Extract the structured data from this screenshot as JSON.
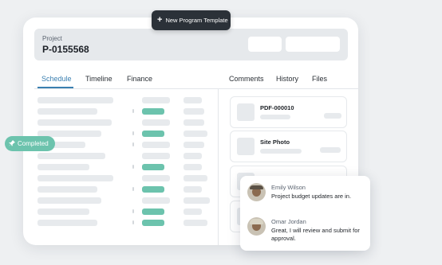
{
  "toolbar": {
    "new_template_label": "New Program Template",
    "plus_icon": "+"
  },
  "project": {
    "label": "Project",
    "id": "P-0155568"
  },
  "tabs_left": [
    "Schedule",
    "Timeline",
    "Finance"
  ],
  "tabs_right": [
    "Comments",
    "History",
    "Files"
  ],
  "status_badge": {
    "label": "Completed"
  },
  "files": [
    {
      "name": "PDF-000010"
    },
    {
      "name": "Site Photo"
    }
  ],
  "comments": [
    {
      "author": "Emily Wilson",
      "text": "Project budget updates are in."
    },
    {
      "author": "Omar Jordan",
      "text": "Great, I will review and submit for approval."
    }
  ],
  "colors": {
    "accent": "#3a7fb0",
    "teal": "#6cc3ad",
    "dark": "#2b3138"
  }
}
